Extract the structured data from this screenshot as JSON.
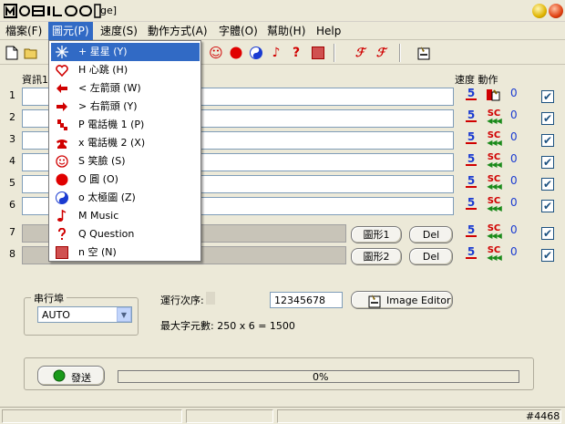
{
  "window": {
    "title_suffix": "ge]",
    "logo_text": "MOBILE"
  },
  "menu": {
    "items": [
      "檔案(F)",
      "圖元(P)",
      "速度(S)",
      "動作方式(A)",
      "字體(O)",
      "幫助(H)",
      "Help"
    ],
    "active_index": 1
  },
  "headers": {
    "info": "資訊1",
    "speed_action": "速度 動作"
  },
  "rows": [
    {
      "num": "1",
      "zero": "0"
    },
    {
      "num": "2",
      "zero": "0"
    },
    {
      "num": "3",
      "zero": "0"
    },
    {
      "num": "4",
      "zero": "0"
    },
    {
      "num": "5",
      "zero": "0"
    },
    {
      "num": "6",
      "zero": "0"
    },
    {
      "num": "7",
      "zero": "0"
    },
    {
      "num": "8",
      "zero": "0"
    }
  ],
  "speed_label": "5",
  "action_sc": "SC",
  "action_arrows": "◀◀◀",
  "graphic_buttons": {
    "shape1": "圖形1",
    "shape2": "圖形2",
    "del": "Del"
  },
  "dropdown": {
    "items": [
      {
        "text": "+ 星星 (Y)",
        "icon": "star-burst-icon",
        "color": "#1a3bd1"
      },
      {
        "text": "H 心跳 (H)",
        "icon": "heart-icon",
        "color": "#d00000"
      },
      {
        "text": "< 左箭頭 (W)",
        "icon": "arrow-left-icon",
        "color": "#d00000"
      },
      {
        "text": "> 右箭頭 (Y)",
        "icon": "arrow-right-icon",
        "color": "#d00000"
      },
      {
        "text": "P 電話機 1 (P)",
        "icon": "phone-icon",
        "color": "#d00000"
      },
      {
        "text": "x 電話機 2 (X)",
        "icon": "telephone-icon",
        "color": "#d00000"
      },
      {
        "text": "S 笑臉 (S)",
        "icon": "smiley-icon",
        "color": "#d00000"
      },
      {
        "text": "O 圓 (O)",
        "icon": "circle-icon",
        "color": "#e00000"
      },
      {
        "text": "o 太極圖 (Z)",
        "icon": "yin-yang-icon",
        "color": "#1a3bd1"
      },
      {
        "text": "M Music",
        "icon": "music-note-icon",
        "color": "#d00000"
      },
      {
        "text": "Q Question",
        "icon": "question-icon",
        "color": "#d00000"
      },
      {
        "text": "n 空 (N)",
        "icon": "empty-square-icon",
        "color": "#d00000"
      }
    ],
    "selected_index": 0
  },
  "serial_port": {
    "label": "串行埠",
    "value": "AUTO"
  },
  "order": {
    "label": "運行次序:",
    "value": "12345678"
  },
  "image_editor": {
    "label": "Image Editor"
  },
  "max_chars": {
    "text": "最大字元數: 250 x 6 = 1500"
  },
  "send": {
    "label": "發送"
  },
  "progress": {
    "text": "0%",
    "value": 0
  },
  "status": {
    "right": "#4468"
  },
  "colors": {
    "accent": "#316ac5",
    "speed": "#1a3bd1",
    "sc": "#d00000",
    "arrows": "#1a8a1a"
  }
}
